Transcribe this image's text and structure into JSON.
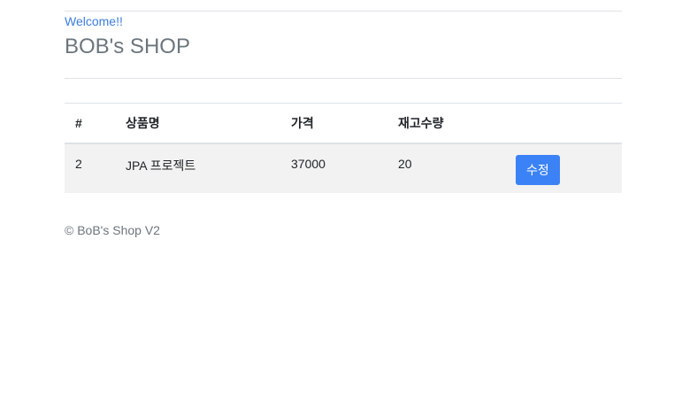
{
  "header": {
    "welcome_link": "Welcome!!",
    "title": "BOB's SHOP"
  },
  "table": {
    "columns": [
      "#",
      "상품명",
      "가격",
      "재고수량",
      ""
    ],
    "rows": [
      {
        "id": "2",
        "name": "JPA 프로젝트",
        "price": "37000",
        "stock": "20",
        "action_label": "수정"
      }
    ]
  },
  "footer": {
    "text": "© BoB's Shop V2"
  },
  "colors": {
    "accent": "#3b82f6",
    "link": "#3b7ddd",
    "muted_text": "#6c757d",
    "row_background": "#f2f2f2"
  }
}
